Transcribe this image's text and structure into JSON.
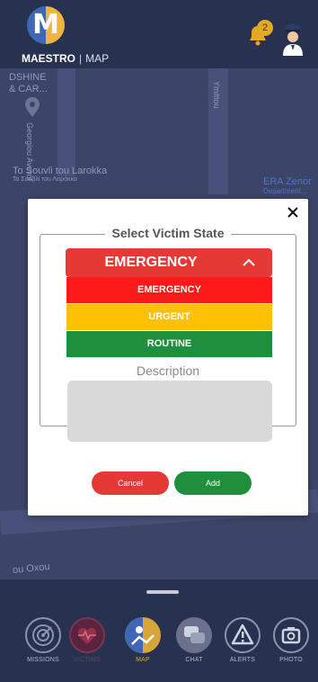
{
  "header": {
    "logo_letter": "M",
    "brand_name": "MAESTRO",
    "brand_separator": "|",
    "section": "MAP",
    "notification_count": "2"
  },
  "map": {
    "labels": [
      "DSHINE",
      "& CAR...",
      "Georgiou Averof",
      "Ymittou",
      "To Souvli tou Larokka",
      "To Σουβλί του Λαρόκκα",
      "ERA Zenor",
      "Department...",
      "ou Oxou"
    ]
  },
  "modal": {
    "title": "Select Victim State",
    "selected": "EMERGENCY",
    "options": [
      {
        "label": "EMERGENCY",
        "color": "#ff1a1a"
      },
      {
        "label": "URGENT",
        "color": "#ffc107"
      },
      {
        "label": "ROUTINE",
        "color": "#1e8f3a"
      }
    ],
    "description_label": "Description",
    "description_value": "",
    "cancel_label": "Cancel",
    "add_label": "Add"
  },
  "bottom_nav": {
    "items": [
      {
        "label": "MISSIONS",
        "icon": "radar-icon"
      },
      {
        "label": "VICTIMS",
        "icon": "heart-pulse-icon"
      },
      {
        "label": "MAP",
        "icon": "map-icon"
      },
      {
        "label": "CHAT",
        "icon": "chat-icon"
      },
      {
        "label": "ALERTS",
        "icon": "warning-icon"
      },
      {
        "label": "PHOTO",
        "icon": "camera-icon"
      }
    ],
    "active": "MAP"
  },
  "colors": {
    "header_bg": "#273150",
    "map_bg": "#3c4468",
    "accent_gold": "#d9a43a",
    "emergency": "#e53935",
    "add_green": "#1e8f3a"
  }
}
